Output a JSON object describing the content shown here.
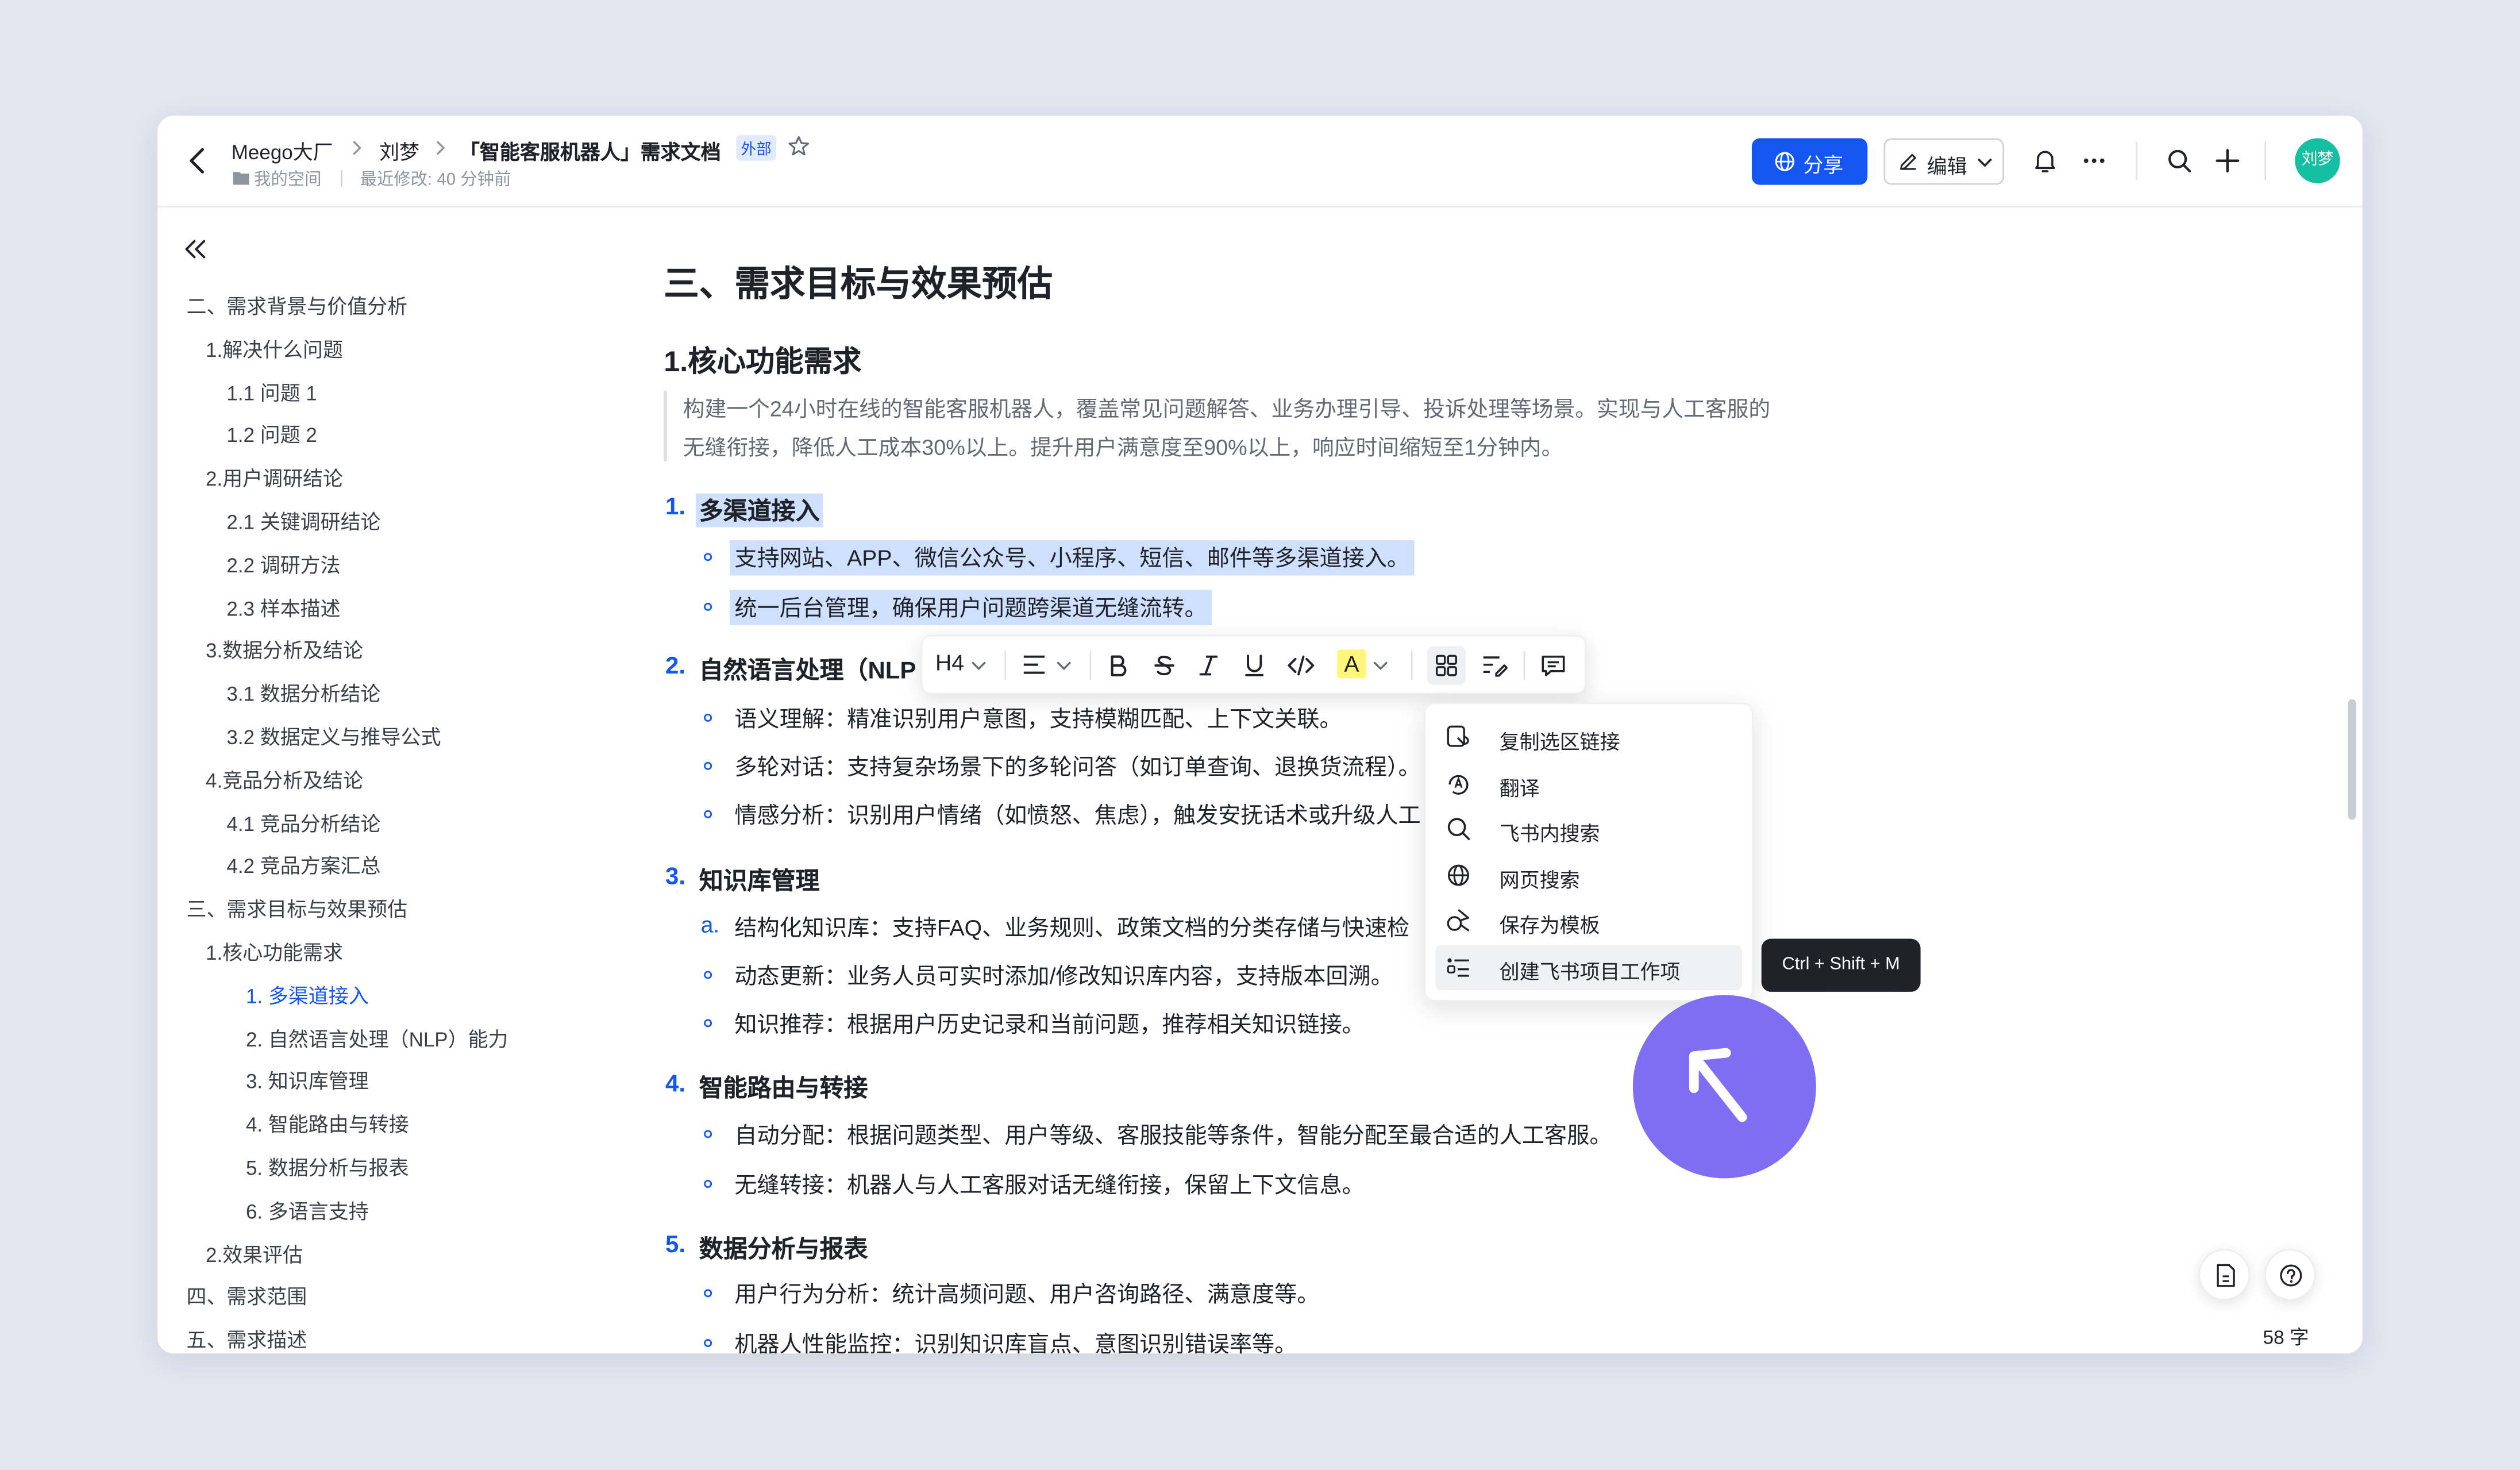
{
  "header": {
    "breadcrumb": [
      "Meego大厂",
      "刘梦",
      "「智能客服机器人」需求文档"
    ],
    "external_tag": "外部",
    "space_label": "我的空间",
    "modified": "最近修改: 40 分钟前",
    "share_label": "分享",
    "edit_label": "编辑",
    "avatar_text": "刘梦",
    "accent": "#1456f0"
  },
  "toc": [
    {
      "label": "二、需求背景与价值分析",
      "level": 0
    },
    {
      "label": "1.解决什么问题",
      "level": 1
    },
    {
      "label": "1.1 问题 1",
      "level": 2
    },
    {
      "label": "1.2 问题 2",
      "level": 2
    },
    {
      "label": "2.用户调研结论",
      "level": 1
    },
    {
      "label": "2.1 关键调研结论",
      "level": 2
    },
    {
      "label": "2.2 调研方法",
      "level": 2
    },
    {
      "label": "2.3 样本描述",
      "level": 2
    },
    {
      "label": "3.数据分析及结论",
      "level": 1
    },
    {
      "label": "3.1 数据分析结论",
      "level": 2
    },
    {
      "label": "3.2 数据定义与推导公式",
      "level": 2
    },
    {
      "label": "4.竞品分析及结论",
      "level": 1
    },
    {
      "label": "4.1 竞品分析结论",
      "level": 2
    },
    {
      "label": "4.2 竞品方案汇总",
      "level": 2
    },
    {
      "label": "三、需求目标与效果预估",
      "level": 0
    },
    {
      "label": "1.核心功能需求",
      "level": 1
    },
    {
      "label": "1. 多渠道接入",
      "level": 3,
      "active": true
    },
    {
      "label": "2. 自然语言处理（NLP）能力",
      "level": 3
    },
    {
      "label": "3. 知识库管理",
      "level": 3
    },
    {
      "label": "4. 智能路由与转接",
      "level": 3
    },
    {
      "label": "5. 数据分析与报表",
      "level": 3
    },
    {
      "label": "6. 多语言支持",
      "level": 3
    },
    {
      "label": "2.效果评估",
      "level": 1
    },
    {
      "label": "四、需求范围",
      "level": 0
    },
    {
      "label": "五、需求描述",
      "level": 0
    }
  ],
  "doc": {
    "h1": "三、需求目标与效果预估",
    "h2": "1.核心功能需求",
    "quote_line1": "构建一个24小时在线的智能客服机器人，覆盖常见问题解答、业务办理引导、投诉处理等场景。实现与人工客服的",
    "quote_line2": "无缝衔接，降低人工成本30%以上。提升用户满意度至90%以上，响应时间缩短至1分钟内。",
    "sections": [
      {
        "num": "1.",
        "title": "多渠道接入",
        "items": [
          "支持网站、APP、微信公众号、小程序、短信、邮件等多渠道接入。",
          "统一后台管理，确保用户问题跨渠道无缝流转。"
        ]
      },
      {
        "num": "2.",
        "title": "自然语言处理（NLP",
        "items": [
          "语义理解：精准识别用户意图，支持模糊匹配、上下文关联。",
          "多轮对话：支持复杂场景下的多轮问答（如订单查询、退换货流程）。",
          "情感分析：识别用户情绪（如愤怒、焦虑），触发安抚话术或升级人工"
        ]
      },
      {
        "num": "3.",
        "title": "知识库管理",
        "item_markers": [
          "a.",
          "",
          ""
        ],
        "items": [
          "结构化知识库：支持FAQ、业务规则、政策文档的分类存储与快速检",
          "动态更新：业务人员可实时添加/修改知识库内容，支持版本回溯。",
          "知识推荐：根据用户历史记录和当前问题，推荐相关知识链接。"
        ]
      },
      {
        "num": "4.",
        "title": "智能路由与转接",
        "items": [
          "自动分配：根据问题类型、用户等级、客服技能等条件，智能分配至最合适的人工客服。",
          "无缝转接：机器人与人工客服对话无缝衔接，保留上下文信息。"
        ]
      },
      {
        "num": "5.",
        "title": "数据分析与报表",
        "items": [
          "用户行为分析：统计高频问题、用户咨询路径、满意度等。",
          "机器人性能监控：识别知识库盲点、意图识别错误率等。"
        ]
      }
    ],
    "word_count": "58 字"
  },
  "toolbar": {
    "heading_label": "H4",
    "highlight_label": "A",
    "icons": [
      "heading-icon",
      "align-icon",
      "bold-icon",
      "strikethrough-icon",
      "italic-icon",
      "underline-icon",
      "code-icon",
      "highlight-icon",
      "block-icon",
      "convert-icon",
      "comment-icon"
    ]
  },
  "context_menu": {
    "items": [
      {
        "label": "复制选区链接",
        "icon": "link-copy-icon"
      },
      {
        "label": "翻译",
        "icon": "translate-icon"
      },
      {
        "label": "飞书内搜索",
        "icon": "search-icon"
      },
      {
        "label": "网页搜索",
        "icon": "globe-icon"
      },
      {
        "label": "保存为模板",
        "icon": "template-icon"
      },
      {
        "label": "创建飞书项目工作项",
        "icon": "work-item-icon",
        "highlighted": true
      }
    ],
    "tooltip": "Ctrl + Shift + M"
  }
}
